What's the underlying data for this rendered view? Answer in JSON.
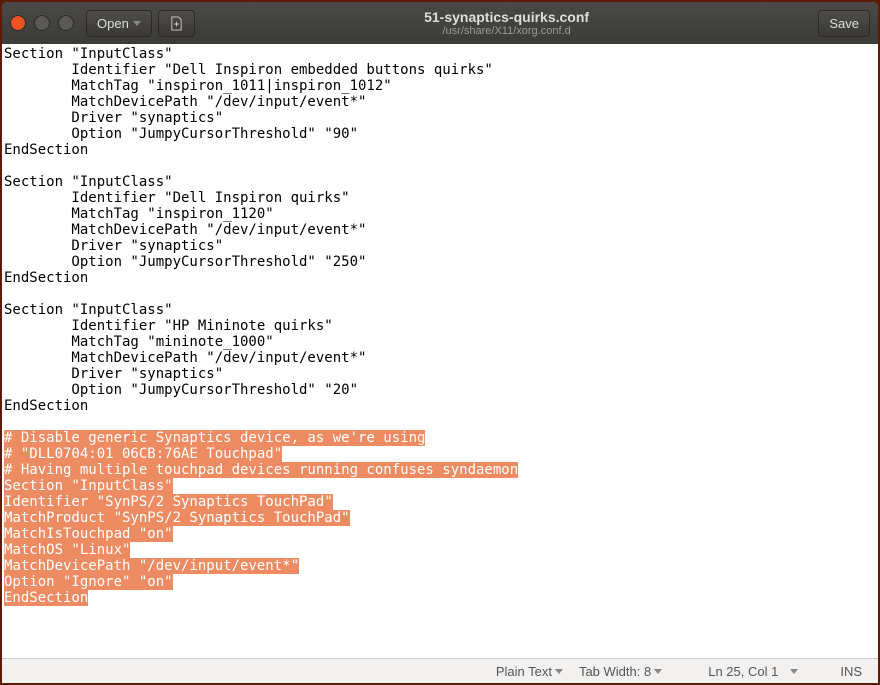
{
  "header": {
    "open_label": "Open",
    "title": "51-synaptics-quirks.conf",
    "subtitle": "/usr/share/X11/xorg.conf.d",
    "save_label": "Save"
  },
  "editor": {
    "plain": "Section \"InputClass\"\n        Identifier \"Dell Inspiron embedded buttons quirks\"\n        MatchTag \"inspiron_1011|inspiron_1012\"\n        MatchDevicePath \"/dev/input/event*\"\n        Driver \"synaptics\"\n        Option \"JumpyCursorThreshold\" \"90\"\nEndSection\n\nSection \"InputClass\"\n        Identifier \"Dell Inspiron quirks\"\n        MatchTag \"inspiron_1120\"\n        MatchDevicePath \"/dev/input/event*\"\n        Driver \"synaptics\"\n        Option \"JumpyCursorThreshold\" \"250\"\nEndSection\n\nSection \"InputClass\"\n        Identifier \"HP Mininote quirks\"\n        MatchTag \"mininote_1000\"\n        MatchDevicePath \"/dev/input/event*\"\n        Driver \"synaptics\"\n        Option \"JumpyCursorThreshold\" \"20\"\nEndSection\n\n",
    "selected": "# Disable generic Synaptics device, as we're using\n# \"DLL0704:01 06CB:76AE Touchpad\"\n# Having multiple touchpad devices running confuses syndaemon\nSection \"InputClass\"\nIdentifier \"SynPS/2 Synaptics TouchPad\"\nMatchProduct \"SynPS/2 Synaptics TouchPad\"\nMatchIsTouchpad \"on\"\nMatchOS \"Linux\"\nMatchDevicePath \"/dev/input/event*\"\nOption \"Ignore\" \"on\"\nEndSection"
  },
  "statusbar": {
    "syntax": "Plain Text",
    "tabwidth": "Tab Width: 8",
    "position": "Ln 25, Col 1",
    "insertmode": "INS"
  }
}
